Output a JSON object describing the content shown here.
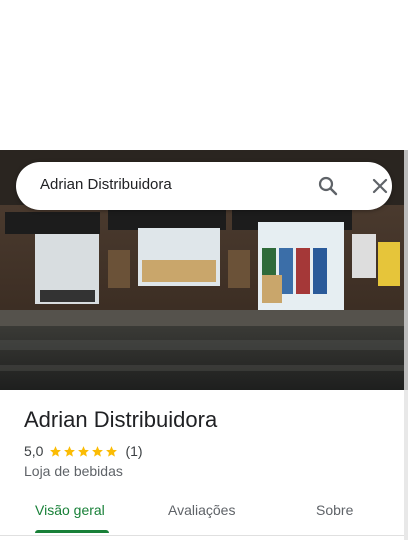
{
  "search": {
    "query": "Adrian Distribuidora",
    "search_icon": "search-icon",
    "close_icon": "close-icon"
  },
  "place": {
    "name": "Adrian Distribuidora",
    "rating": "5,0",
    "stars": 5,
    "review_count": "(1)",
    "category": "Loja de bebidas",
    "photo": "storefront-photo"
  },
  "tabs": [
    {
      "label": "Visão geral",
      "active": true
    },
    {
      "label": "Avaliações",
      "active": false
    },
    {
      "label": "Sobre",
      "active": false
    }
  ],
  "colors": {
    "accent": "#188038",
    "star": "#fbbc04",
    "text_primary": "#202124",
    "text_secondary": "#5f6368"
  }
}
